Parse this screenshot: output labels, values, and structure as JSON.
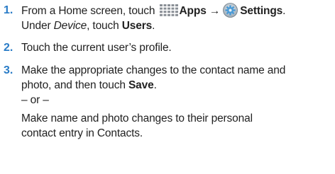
{
  "steps": [
    {
      "number": "1.",
      "line1": {
        "pre": "From a Home screen, touch ",
        "apps": "Apps",
        "arrow": "→",
        "settings": "Settings",
        "end": "."
      },
      "line2": {
        "pre": "Under ",
        "device": "Device",
        "mid": ", touch ",
        "users": "Users",
        "end": "."
      }
    },
    {
      "number": "2.",
      "text": "Touch the current user’s profile."
    },
    {
      "number": "3.",
      "line1": "Make the appropriate changes to the contact name and",
      "line2": {
        "pre": "photo, and then touch ",
        "save": "Save",
        "end": "."
      },
      "or": "– or –",
      "alt_line1": "Make name and photo changes to their personal",
      "alt_line2": "contact entry in Contacts."
    }
  ],
  "icons": {
    "apps": "apps-grid-icon",
    "settings": "settings-gear-icon"
  }
}
